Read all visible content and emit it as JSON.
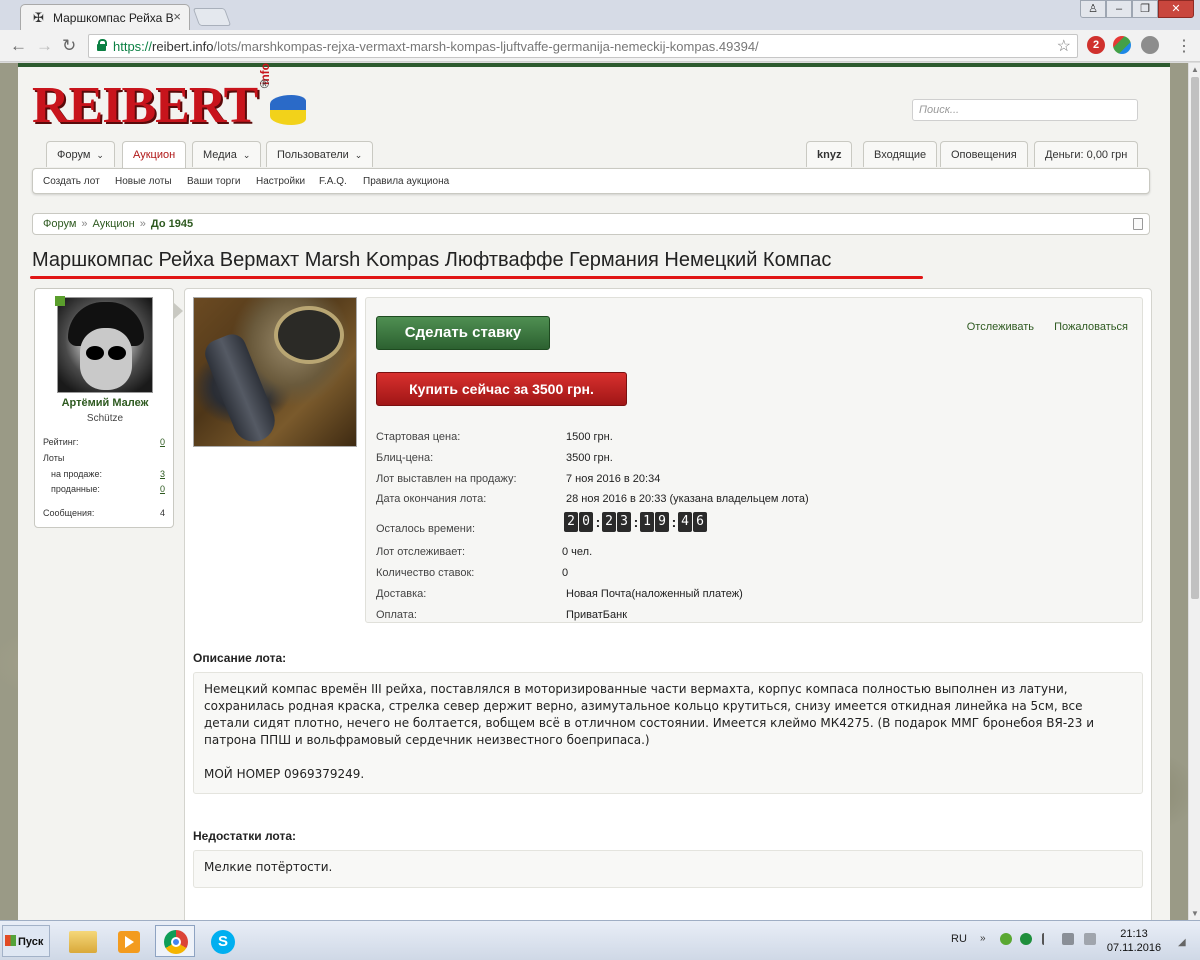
{
  "browser": {
    "tab_title": "Маршкомпас Рейха Вер",
    "tab_close": "×",
    "url_https": "https://",
    "url_host": "reibert.info",
    "url_path": "/lots/marshkompas-rejxa-vermaxt-marsh-kompas-ljuftvaffe-germanija-nemeckij-kompas.49394/",
    "ext_badge": "2"
  },
  "header": {
    "logo_text": "REIBERT",
    "logo_suffix": "info",
    "logo_reg": "®",
    "search_placeholder": "Поиск..."
  },
  "nav": {
    "tabs": [
      {
        "label": "Форум",
        "chevron": "⌄"
      },
      {
        "label": "Аукцион"
      },
      {
        "label": "Медиа",
        "chevron": "⌄"
      },
      {
        "label": "Пользователи",
        "chevron": "⌄"
      }
    ],
    "right_tabs": [
      {
        "label": "knyz"
      },
      {
        "label": "Входящие"
      },
      {
        "label": "Оповещения"
      },
      {
        "label": "Деньги: 0,00 грн"
      }
    ],
    "sub_items": [
      "Создать лот",
      "Новые лоты",
      "Ваши торги",
      "Настройки",
      "F.A.Q.",
      "Правила аукциона"
    ]
  },
  "breadcrumb": {
    "items": [
      "Форум",
      "Аукцион"
    ],
    "separator": "»",
    "current": "До 1945"
  },
  "page_title": "Маршкомпас Рейха Вермахт Marsh Kompas Люфтваффе Германия Немецкий Компас",
  "user": {
    "name": "Артёмий Малеж",
    "rank": "Schütze",
    "stats": [
      {
        "label": "Рейтинг:",
        "value": "0"
      },
      {
        "label": "Лоты",
        "value": ""
      },
      {
        "label": "на продаже:",
        "value": "3"
      },
      {
        "label": "проданные:",
        "value": "0"
      },
      {
        "label": "Сообщения:",
        "value": "4"
      }
    ]
  },
  "lot": {
    "bid_button": "Сделать ставку",
    "buy_button": "Купить сейчас за 3500 грн.",
    "follow_link": "Отслеживать",
    "report_link": "Пожаловаться",
    "rows": [
      {
        "label": "Стартовая цена:",
        "value": "1500 грн."
      },
      {
        "label": "Блиц-цена:",
        "value": "3500 грн."
      },
      {
        "label": "Лот выставлен на продажу:",
        "value": "7 ноя 2016 в 20:34"
      },
      {
        "label": "Дата окончания лота:",
        "value": "28 ноя 2016 в 20:33 (указана владельцем лота)"
      }
    ],
    "time_left_label": "Осталось времени:",
    "timer": {
      "days": [
        "2",
        "0"
      ],
      "hours": [
        "2",
        "3"
      ],
      "minutes": [
        "1",
        "9"
      ],
      "seconds": [
        "4",
        "6"
      ],
      "separator": ":"
    },
    "rows2": [
      {
        "label": "Лот отслеживает:",
        "value": "0 чел."
      },
      {
        "label": "Количество ставок:",
        "value": "0"
      },
      {
        "label": "Доставка:",
        "value": "Новая Почта(наложенный платеж)"
      },
      {
        "label": "Оплата:",
        "value": "ПриватБанк"
      }
    ]
  },
  "description": {
    "title": "Описание лота:",
    "lines": [
      "Немецкий компас времён III рейха, поставлялся в моторизированные части вермахта, корпус компаса полностью выполнен из латуни,",
      "сохранилась родная краска, стрелка север держит верно, азимутальное кольцо крутиться, снизу имеется откидная линейка на 5см, все",
      "детали сидят плотно, нечего не болтается, вобщем всё в отличном состоянии. Имеется клеймо МК4275. (В подарок ММГ бронебоя ВЯ-23 и",
      "патрона ППШ и вольфрамовый сердечник неизвестного боеприпаса.)"
    ],
    "phone": "МОЙ НОМЕР 0969379249."
  },
  "flaws": {
    "title": "Недостатки лота:",
    "text": "Мелкие потёртости."
  },
  "taskbar": {
    "start_label": "Пуск",
    "lang": "RU",
    "time": "21:13",
    "date": "07.11.2016"
  }
}
